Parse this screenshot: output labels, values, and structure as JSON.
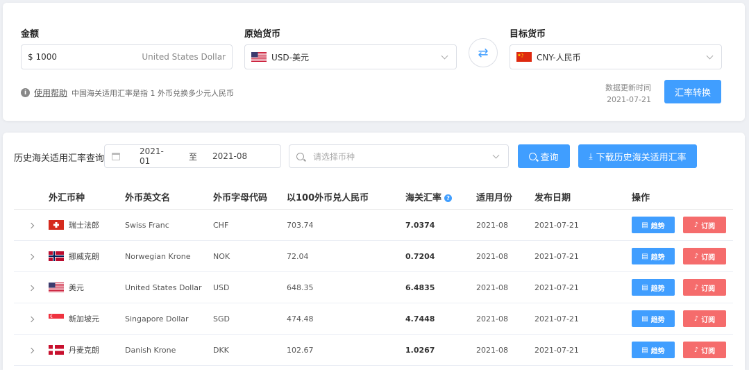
{
  "converter": {
    "amount_label": "金额",
    "amount_value": "$ 1000",
    "amount_currency_name": "United States Dollar",
    "from_label": "原始货币",
    "from_value": "USD-美元",
    "to_label": "目标货币",
    "to_value": "CNY-人民币",
    "swap_icon": "⇄",
    "help_link": "使用帮助",
    "help_text": "中国海关适用汇率是指 1 外币兑换多少元人民币",
    "update_label": "数据更新时间",
    "update_date": "2021-07-21",
    "convert_button": "汇率转换"
  },
  "history": {
    "title": "历史海关适用汇率查询",
    "date_start": "2021-01",
    "date_sep": "至",
    "date_end": "2021-08",
    "currency_placeholder": "请选择币种",
    "query_button": "查询",
    "download_button": "下载历史海关适用汇率",
    "columns": [
      "外汇币种",
      "外币英文名",
      "外币字母代码",
      "以100外币兑人民币",
      "海关汇率",
      "适用月份",
      "发布日期",
      "操作"
    ],
    "rows": [
      {
        "flag": "CH",
        "name_cn": "瑞士法郎",
        "name_en": "Swiss Franc",
        "code": "CHF",
        "per100": "703.74",
        "rate": "7.0374",
        "month": "2021-08",
        "date": "2021-07-21"
      },
      {
        "flag": "NO",
        "name_cn": "挪威克朗",
        "name_en": "Norwegian Krone",
        "code": "NOK",
        "per100": "72.04",
        "rate": "0.7204",
        "month": "2021-08",
        "date": "2021-07-21"
      },
      {
        "flag": "US",
        "name_cn": "美元",
        "name_en": "United States Dollar",
        "code": "USD",
        "per100": "648.35",
        "rate": "6.4835",
        "month": "2021-08",
        "date": "2021-07-21"
      },
      {
        "flag": "SG",
        "name_cn": "新加坡元",
        "name_en": "Singapore Dollar",
        "code": "SGD",
        "per100": "474.48",
        "rate": "4.7448",
        "month": "2021-08",
        "date": "2021-07-21"
      },
      {
        "flag": "DK",
        "name_cn": "丹麦克朗",
        "name_en": "Danish Krone",
        "code": "DKK",
        "per100": "102.67",
        "rate": "1.0267",
        "month": "2021-08",
        "date": "2021-07-21"
      }
    ],
    "trend_label": "趋势",
    "subscribe_label": "订阅"
  },
  "colors": {
    "accent": "#409eff",
    "danger": "#f56c6c",
    "background": "#eef0f4"
  }
}
